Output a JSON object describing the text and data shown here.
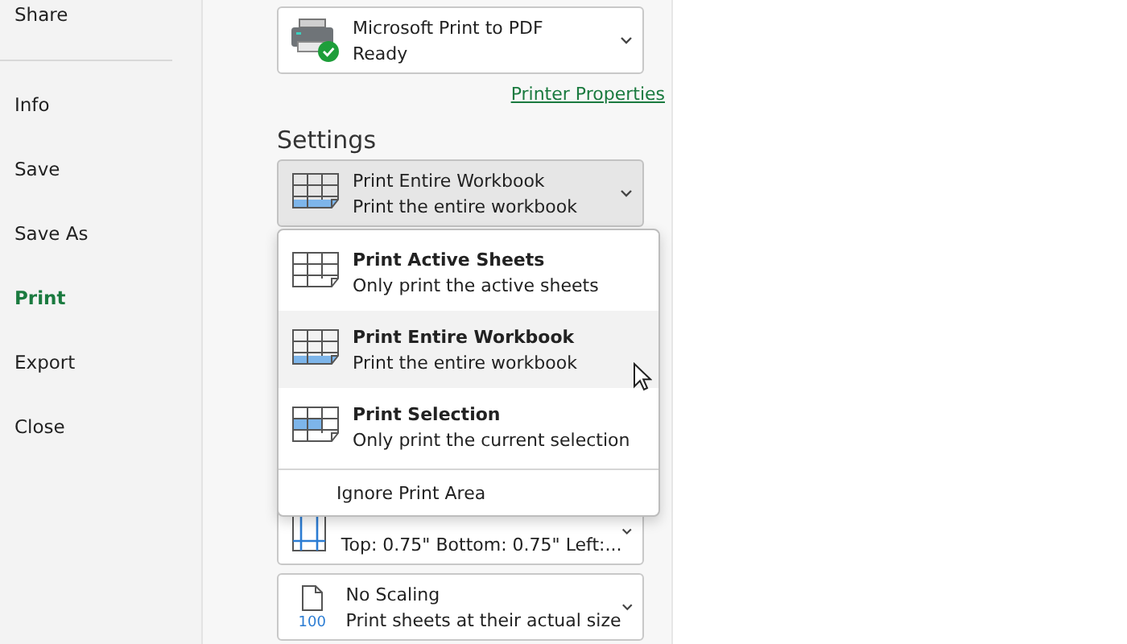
{
  "sidebar": {
    "items": [
      {
        "label": "Share",
        "selected": false
      },
      {
        "label": "Info",
        "selected": false
      },
      {
        "label": "Save",
        "selected": false
      },
      {
        "label": "Save As",
        "selected": false
      },
      {
        "label": "Print",
        "selected": true
      },
      {
        "label": "Export",
        "selected": false
      },
      {
        "label": "Close",
        "selected": false
      }
    ]
  },
  "printer": {
    "name": "Microsoft Print to PDF",
    "status": "Ready",
    "properties_link": "Printer Properties"
  },
  "settings": {
    "heading": "Settings",
    "current": {
      "kind": "workbook",
      "title": "Print Entire Workbook",
      "subtitle": "Print the entire workbook"
    },
    "menu": {
      "items": [
        {
          "kind": "sheets",
          "title": "Print Active Sheets",
          "subtitle": "Only print the active sheets",
          "hovered": false
        },
        {
          "kind": "workbook",
          "title": "Print Entire Workbook",
          "subtitle": "Print the entire workbook",
          "hovered": true
        },
        {
          "kind": "selection",
          "title": "Print Selection",
          "subtitle": "Only print the current selection",
          "hovered": false
        }
      ],
      "option": "Ignore Print Area"
    },
    "margins": {
      "subtitle": "Top: 0.75\" Bottom: 0.75\" Left:..."
    },
    "scaling": {
      "title": "No Scaling",
      "subtitle": "Print sheets at their actual size",
      "badge": "100"
    }
  }
}
